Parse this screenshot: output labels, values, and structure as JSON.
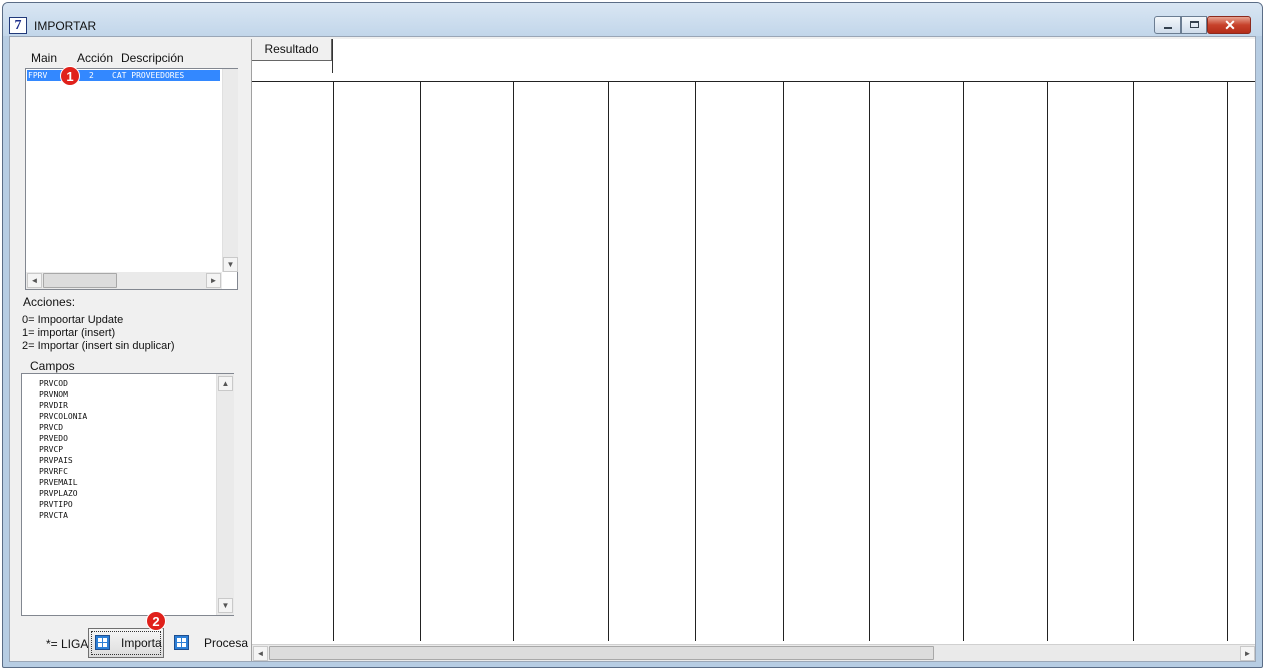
{
  "window": {
    "title": "IMPORTAR",
    "icon_glyph": "7"
  },
  "main_list": {
    "headers": {
      "main": "Main",
      "accion": "Acción",
      "descripcion": "Descripción"
    },
    "rows": [
      {
        "main": "FPRV",
        "accion": "2",
        "descripcion": "CAT PROVEEDORES"
      }
    ]
  },
  "acciones": {
    "title": "Acciones:",
    "lines": [
      "0= Impoortar Update",
      "1= importar (insert)",
      "2= Importar (insert sin duplicar)"
    ]
  },
  "campos": {
    "title": "Campos",
    "items": [
      "PRVCOD",
      "PRVNOM",
      "PRVDIR",
      "PRVCOLONIA",
      "PRVCD",
      "PRVEDO",
      "PRVCP",
      "PRVPAIS",
      "PRVRFC",
      "PRVEMAIL",
      "PRVPLAZO",
      "PRVTIPO",
      "PRVCTA"
    ]
  },
  "footer": {
    "liga_label": "*= LIGA",
    "importa_label": "Importa",
    "procesa_label": "Procesa"
  },
  "badges": {
    "one": "1",
    "two": "2"
  },
  "grid": {
    "tab_label": "Resultado"
  },
  "colors": {
    "selection": "#3388ff",
    "badge": "#e0211b",
    "close_button": "#c7412b"
  }
}
